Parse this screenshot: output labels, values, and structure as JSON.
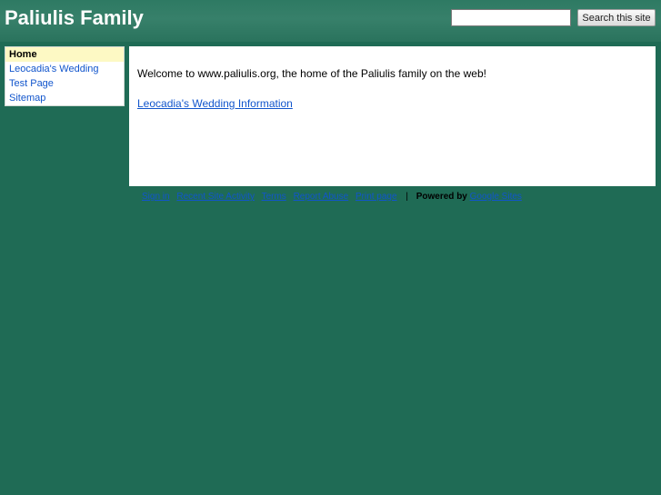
{
  "site": {
    "title": "Paliulis Family"
  },
  "search": {
    "placeholder": "",
    "button_label": "Search this site"
  },
  "sidebar": {
    "items": [
      {
        "label": "Home",
        "active": true
      },
      {
        "label": "Leocadia's Wedding",
        "active": false
      },
      {
        "label": "Test Page",
        "active": false
      },
      {
        "label": "Sitemap",
        "active": false
      }
    ]
  },
  "main": {
    "welcome_text": "Welcome to www.paliulis.org, the home of the Paliulis family on the web!",
    "wedding_link": "Leocadia's Wedding Information"
  },
  "footer": {
    "links": [
      "Sign in",
      "Recent Site Activity",
      "Terms",
      "Report Abuse",
      "Print page"
    ],
    "separator": "|",
    "powered_by_label": "Powered by",
    "powered_by_link": "Google Sites"
  },
  "colors": {
    "background": "#1f6b55",
    "link": "#1155cc",
    "active_nav": "#fdf9c4"
  }
}
